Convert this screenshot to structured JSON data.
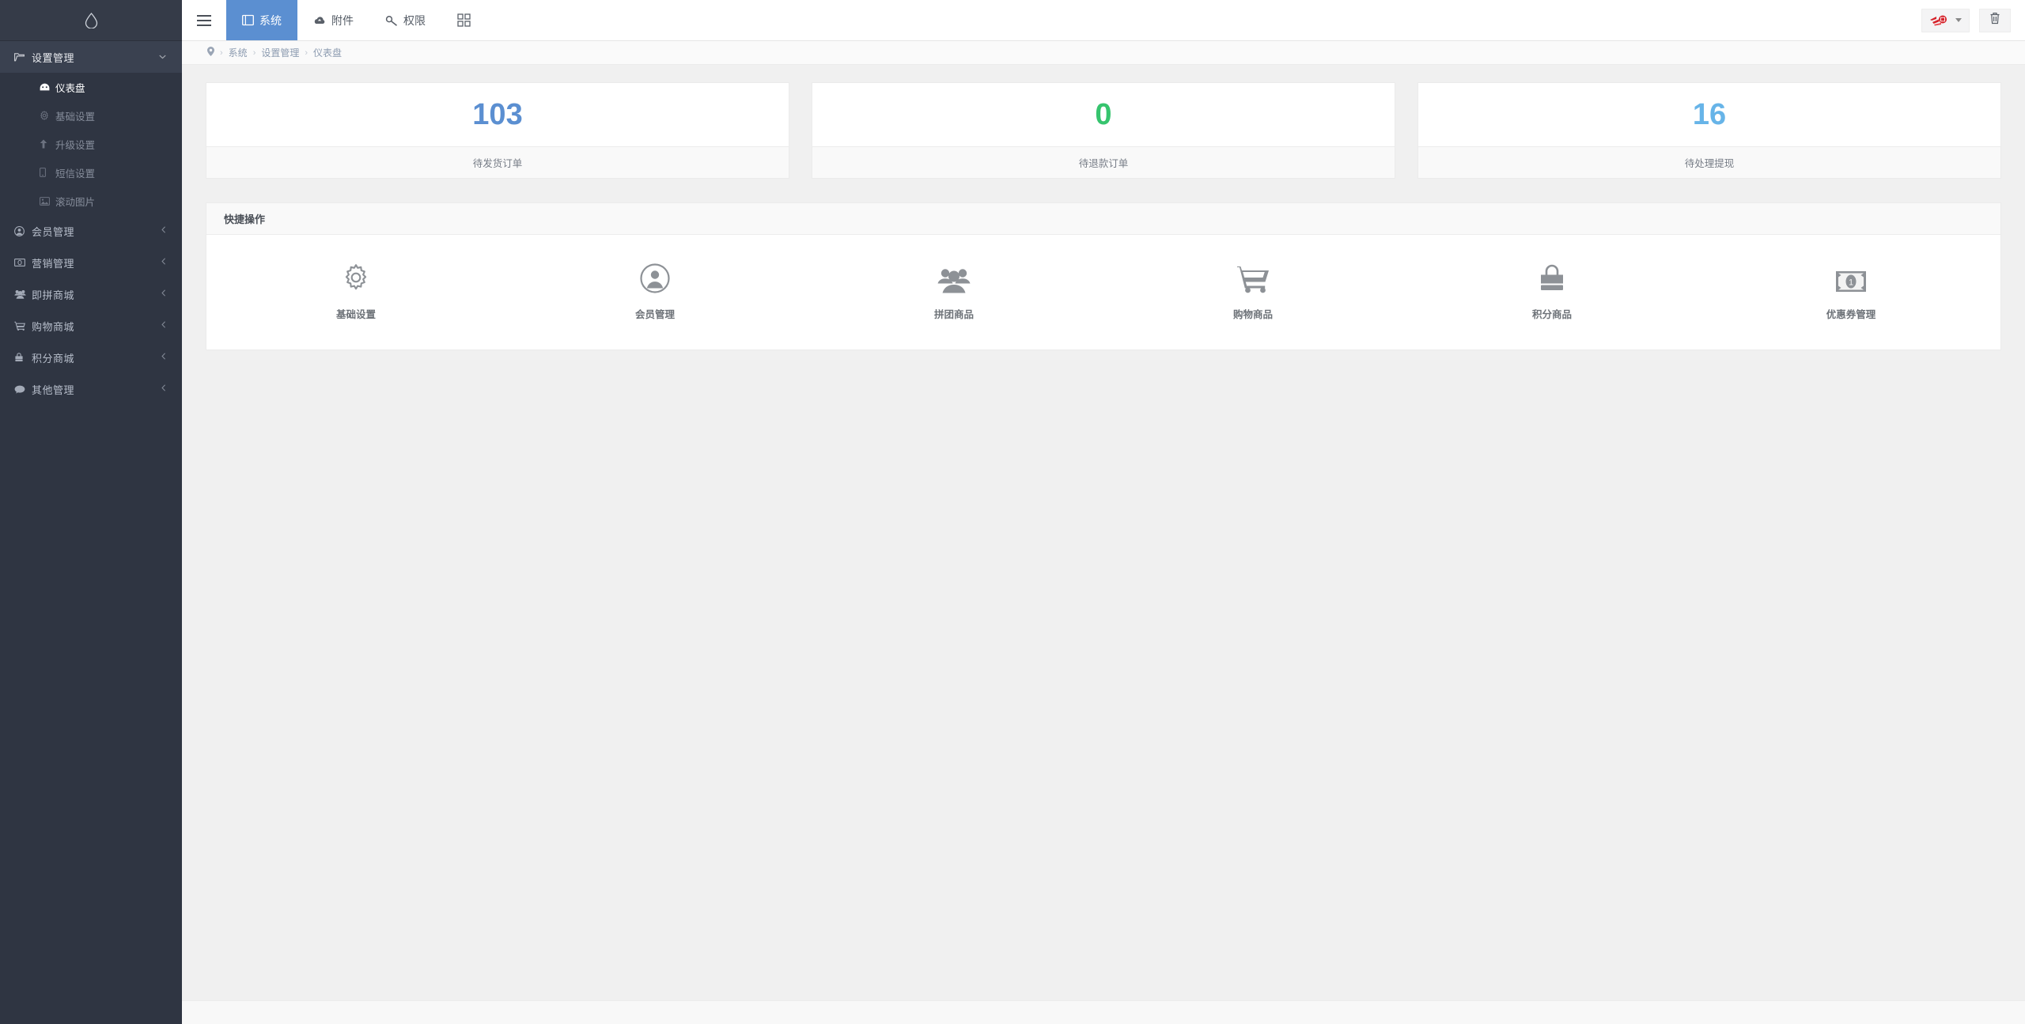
{
  "sidebar": {
    "logo_icon": "water-drop-icon",
    "groups": [
      {
        "label": "设置管理",
        "icon": "folder-open-icon",
        "arrow": "chevron-down-icon",
        "open": true,
        "children": [
          {
            "label": "仪表盘",
            "icon": "dashboard-icon",
            "active": true
          },
          {
            "label": "基础设置",
            "icon": "gear-icon",
            "active": false
          },
          {
            "label": "升级设置",
            "icon": "arrow-up-icon",
            "active": false
          },
          {
            "label": "短信设置",
            "icon": "mobile-icon",
            "active": false
          },
          {
            "label": "滚动图片",
            "icon": "image-icon",
            "active": false
          }
        ]
      },
      {
        "label": "会员管理",
        "icon": "user-circle-icon",
        "arrow": "chevron-left-icon",
        "open": false,
        "children": []
      },
      {
        "label": "营销管理",
        "icon": "money-icon",
        "arrow": "chevron-left-icon",
        "open": false,
        "children": []
      },
      {
        "label": "即拼商城",
        "icon": "users-icon",
        "arrow": "chevron-left-icon",
        "open": false,
        "children": []
      },
      {
        "label": "购物商城",
        "icon": "cart-icon",
        "arrow": "chevron-left-icon",
        "open": false,
        "children": []
      },
      {
        "label": "积分商城",
        "icon": "bag-icon",
        "arrow": "chevron-left-icon",
        "open": false,
        "children": []
      },
      {
        "label": "其他管理",
        "icon": "comment-icon",
        "arrow": "chevron-left-icon",
        "open": false,
        "children": []
      }
    ]
  },
  "header": {
    "menu_toggle_icon": "hamburger-icon",
    "tabs": [
      {
        "label": "系统",
        "icon": "window-icon",
        "active": true
      },
      {
        "label": "附件",
        "icon": "cloud-icon",
        "active": false
      },
      {
        "label": "权限",
        "icon": "key-icon",
        "active": false
      },
      {
        "label": "",
        "icon": "grid-icon",
        "active": false
      }
    ],
    "user_logo_icon": "brand-logo-icon",
    "user_caret_icon": "caret-down-icon",
    "trash_icon": "trash-icon"
  },
  "breadcrumb": {
    "home_icon": "location-pin-icon",
    "separator": "›",
    "items": [
      "系统",
      "设置管理",
      "仪表盘"
    ]
  },
  "stats": [
    {
      "value": "103",
      "label": "待发货订单",
      "color": "#5b8fd1"
    },
    {
      "value": "0",
      "label": "待退款订单",
      "color": "#36c46e"
    },
    {
      "value": "16",
      "label": "待处理提现",
      "color": "#67b4e8"
    }
  ],
  "quick_actions": {
    "title": "快捷操作",
    "items": [
      {
        "label": "基础设置",
        "icon": "gear-outline-icon"
      },
      {
        "label": "会员管理",
        "icon": "user-circle-filled-icon"
      },
      {
        "label": "拼团商品",
        "icon": "users-group-icon"
      },
      {
        "label": "购物商品",
        "icon": "shopping-cart-icon"
      },
      {
        "label": "积分商品",
        "icon": "shopping-bag-icon"
      },
      {
        "label": "优惠券管理",
        "icon": "banknote-icon"
      }
    ]
  },
  "theme": {
    "sidebar_bg": "#2f3542",
    "sidebar_active_bg": "#3a4150",
    "accent": "#5b8fd1",
    "page_bg": "#f0f0f0"
  }
}
